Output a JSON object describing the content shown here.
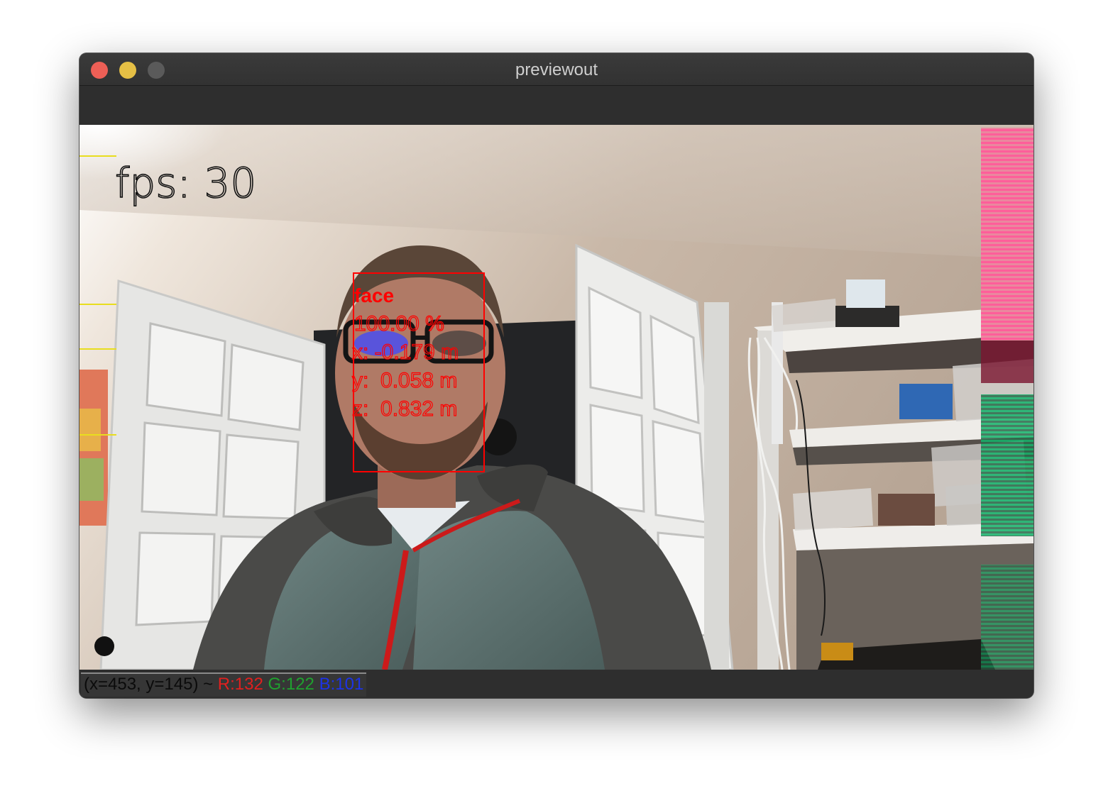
{
  "window": {
    "title": "previewout"
  },
  "overlay": {
    "fps_text": "fps: 30",
    "detection": {
      "label": "face",
      "confidence": "100.00 %",
      "x_line": "x: -0.179 m",
      "y_line": "y:  0.058 m",
      "z_line": "z:  0.832 m",
      "box_color": "#ff0000"
    }
  },
  "statusbar": {
    "coords": "(x=453, y=145) ~",
    "r": "R:132",
    "g": "G:122",
    "b": "B:101"
  },
  "colors": {
    "close": "#ed5f56",
    "minimize": "#e5bf45",
    "maximize": "#5a5a5a",
    "r_text": "#e0201f",
    "g_text": "#1fa12f",
    "b_text": "#1c33e8"
  },
  "icons": [
    "close-button-icon",
    "minimize-button-icon",
    "maximize-button-icon"
  ]
}
